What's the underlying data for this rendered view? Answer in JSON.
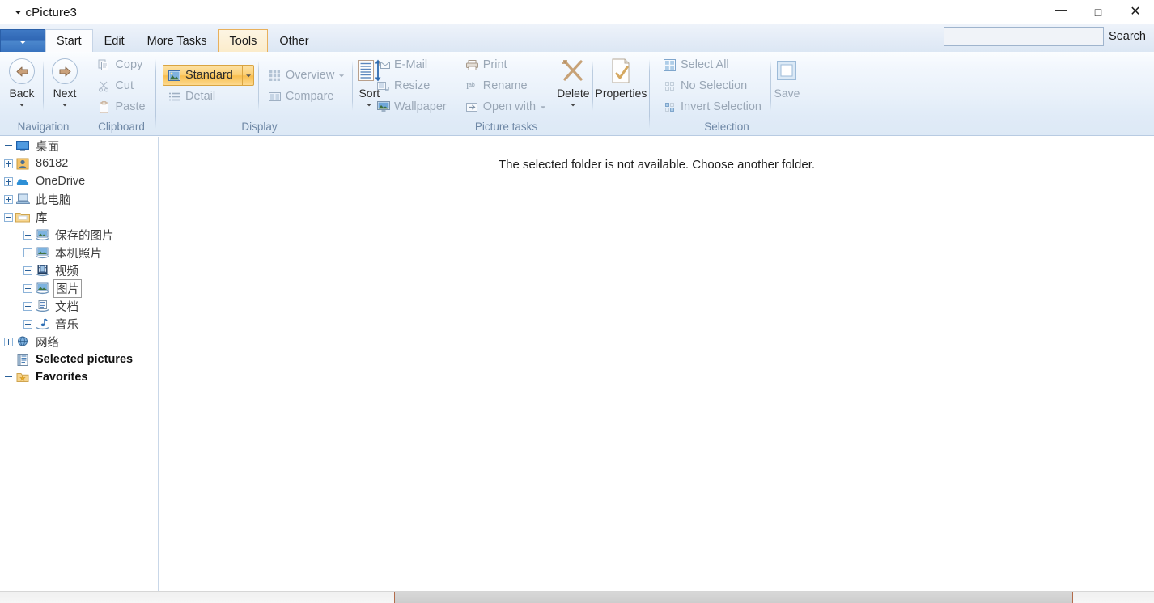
{
  "window": {
    "title": "cPicture3",
    "qat_icon": "chevron-down-icon",
    "minimize": "—",
    "maximize": "□",
    "close": "✕"
  },
  "tabs": {
    "app_button": "▼",
    "items": [
      {
        "label": "Start",
        "state": "active"
      },
      {
        "label": "Edit",
        "state": "normal"
      },
      {
        "label": "More Tasks",
        "state": "normal"
      },
      {
        "label": "Tools",
        "state": "hover"
      },
      {
        "label": "Other",
        "state": "normal"
      }
    ]
  },
  "search": {
    "value": "",
    "placeholder": "",
    "label": "Search"
  },
  "ribbon": {
    "groups": [
      {
        "name": "Navigation",
        "label": "Navigation",
        "big_buttons": [
          {
            "label": "Back",
            "icon": "back-arrow-icon",
            "has_caret": true,
            "disabled": false
          },
          {
            "label": "Next",
            "icon": "next-arrow-icon",
            "has_caret": true,
            "disabled": false
          }
        ]
      },
      {
        "name": "Clipboard",
        "label": "Clipboard",
        "small_buttons": [
          {
            "label": "Copy",
            "icon": "copy-icon",
            "disabled": true
          },
          {
            "label": "Cut",
            "icon": "scissors-icon",
            "disabled": true
          },
          {
            "label": "Paste",
            "icon": "clipboard-icon",
            "disabled": true
          }
        ]
      },
      {
        "name": "Display",
        "label": "Display",
        "col_a": [
          {
            "label": "Standard",
            "icon": "picture-icon",
            "checked": true,
            "split": true
          },
          {
            "label": "Detail",
            "icon": "list-icon",
            "disabled": true
          }
        ],
        "col_b": [
          {
            "label": "Overview",
            "icon": "grid-icon",
            "disabled": true,
            "caret": true
          },
          {
            "label": "Compare",
            "icon": "compare-icon",
            "disabled": true
          }
        ],
        "sort": {
          "label": "Sort",
          "icon": "sort-icon",
          "has_caret": true
        }
      },
      {
        "name": "Picture tasks",
        "label": "Picture tasks",
        "col_a": [
          {
            "label": "E-Mail",
            "icon": "mail-icon",
            "disabled": true
          },
          {
            "label": "Resize",
            "icon": "resize-icon",
            "disabled": true
          },
          {
            "label": "Wallpaper",
            "icon": "wallpaper-icon",
            "disabled": true
          }
        ],
        "col_b": [
          {
            "label": "Print",
            "icon": "printer-icon",
            "disabled": true
          },
          {
            "label": "Rename",
            "icon": "rename-icon",
            "disabled": true
          },
          {
            "label": "Open with",
            "icon": "open-with-icon",
            "disabled": true,
            "caret": true
          }
        ],
        "delete": {
          "label": "Delete",
          "icon": "delete-x-icon",
          "has_caret": true
        },
        "properties": {
          "label": "Properties",
          "icon": "properties-icon"
        }
      },
      {
        "name": "Selection",
        "label": "Selection",
        "small_buttons": [
          {
            "label": "Select All",
            "icon": "select-all-icon",
            "disabled": true
          },
          {
            "label": "No Selection",
            "icon": "no-selection-icon",
            "disabled": true
          },
          {
            "label": "Invert Selection",
            "icon": "invert-selection-icon",
            "disabled": true
          }
        ],
        "save": {
          "label": "Save",
          "icon": "save-icon",
          "disabled": true
        }
      }
    ]
  },
  "sidebar": {
    "items": [
      {
        "label": "桌面",
        "icon": "desktop-icon",
        "indent": 0,
        "expander": "none",
        "bold": false,
        "selected": false
      },
      {
        "label": "86182",
        "icon": "user-icon",
        "indent": 0,
        "expander": "plus",
        "bold": false,
        "selected": false
      },
      {
        "label": "OneDrive",
        "icon": "cloud-icon",
        "indent": 0,
        "expander": "plus",
        "bold": false,
        "selected": false
      },
      {
        "label": "此电脑",
        "icon": "computer-icon",
        "indent": 0,
        "expander": "plus",
        "bold": false,
        "selected": false
      },
      {
        "label": "库",
        "icon": "library-folder-icon",
        "indent": 0,
        "expander": "minus",
        "bold": false,
        "selected": false
      },
      {
        "label": "保存的图片",
        "icon": "picture-library-icon",
        "indent": 1,
        "expander": "plus",
        "bold": false,
        "selected": false
      },
      {
        "label": "本机照片",
        "icon": "picture-library-icon",
        "indent": 1,
        "expander": "plus",
        "bold": false,
        "selected": false
      },
      {
        "label": "视频",
        "icon": "video-library-icon",
        "indent": 1,
        "expander": "plus",
        "bold": false,
        "selected": false
      },
      {
        "label": "图片",
        "icon": "picture-library-icon",
        "indent": 1,
        "expander": "plus",
        "bold": false,
        "selected": true
      },
      {
        "label": "文档",
        "icon": "document-library-icon",
        "indent": 1,
        "expander": "plus",
        "bold": false,
        "selected": false
      },
      {
        "label": "音乐",
        "icon": "music-library-icon",
        "indent": 1,
        "expander": "plus",
        "bold": false,
        "selected": false
      },
      {
        "label": "网络",
        "icon": "network-icon",
        "indent": 0,
        "expander": "plus",
        "bold": false,
        "selected": false
      },
      {
        "label": "Selected pictures",
        "icon": "selected-pictures-icon",
        "indent": 0,
        "expander": "none",
        "bold": true,
        "selected": false
      },
      {
        "label": "Favorites",
        "icon": "favorites-icon",
        "indent": 0,
        "expander": "none",
        "bold": true,
        "selected": false
      }
    ]
  },
  "content": {
    "message": "The selected folder is not available. Choose another folder."
  },
  "colors": {
    "accent_blue": "#2f66b4",
    "highlight_amber": "#f8bd4c",
    "ribbon_bg": "#e9f1fa",
    "group_label": "#6e87a5",
    "disabled_text": "#9aa7b6",
    "tab_hover_border": "#e8b05c"
  }
}
